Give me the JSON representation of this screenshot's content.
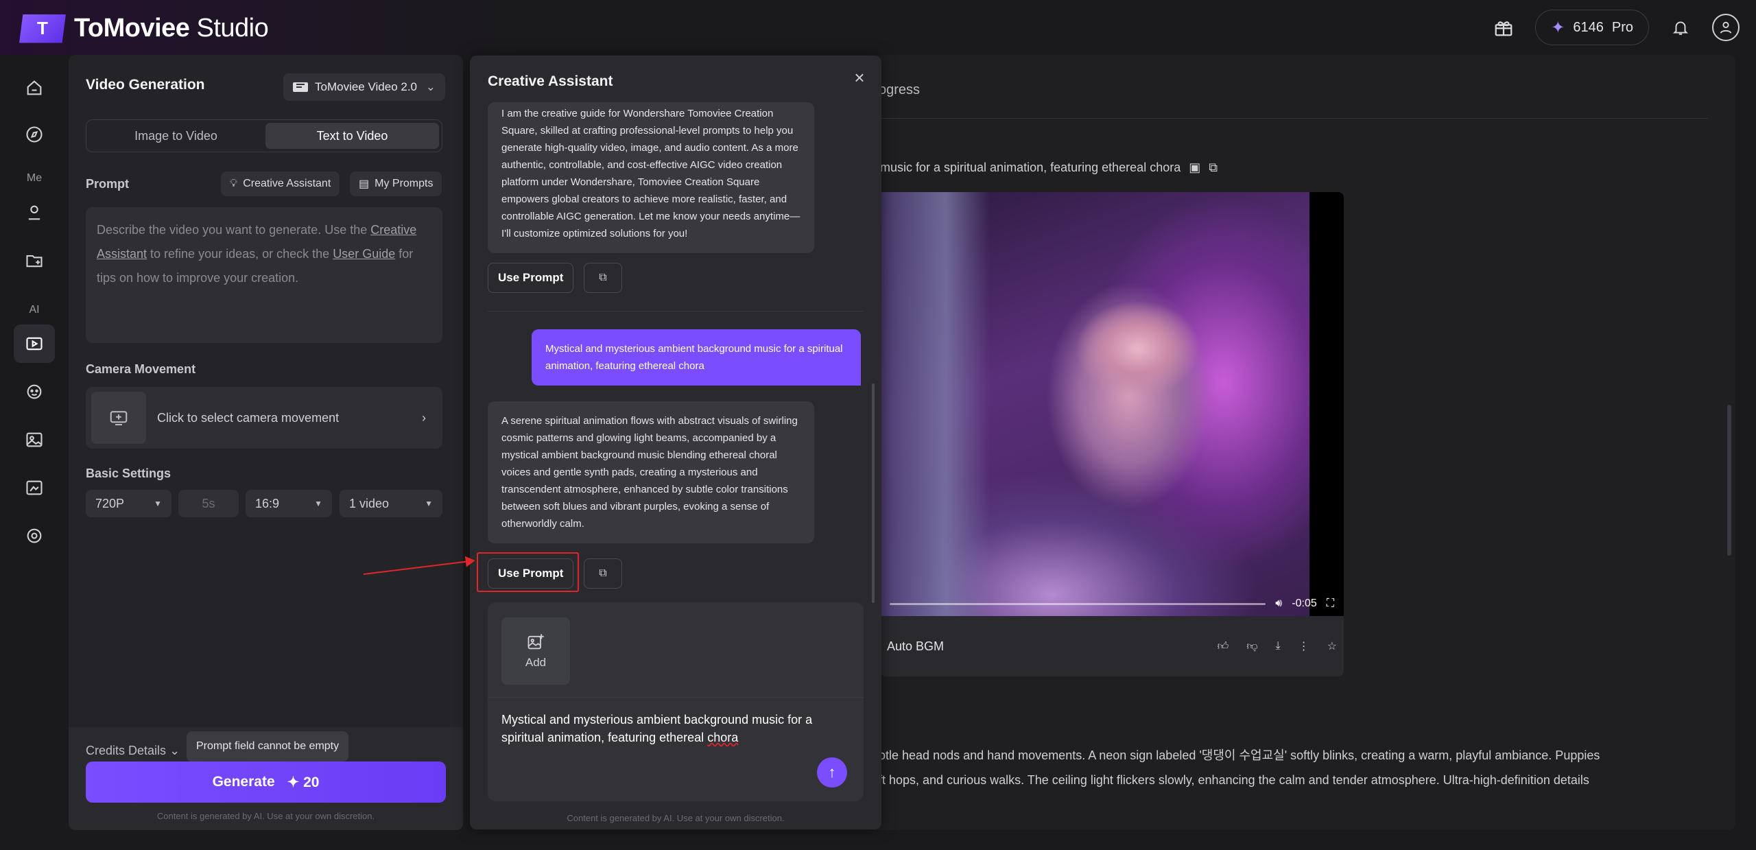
{
  "app": {
    "logo_mark": "T",
    "name_bold": "ToMoviee",
    "name_light": " Studio"
  },
  "topbar": {
    "credits": "6146",
    "plan": "Pro",
    "icons": [
      "gift-icon",
      "sparkle-icon",
      "bell-icon",
      "user-icon"
    ]
  },
  "sidenav": {
    "section_me": "Me",
    "section_ai": "AI"
  },
  "left_panel": {
    "title": "Video Generation",
    "model": "ToMoviee Video 2.0",
    "tabs": [
      "Image to Video",
      "Text to Video"
    ],
    "active_tab": "Text to Video",
    "prompt_label": "Prompt",
    "creative_assistant_chip": "Creative Assistant",
    "my_prompts_chip": "My Prompts",
    "prompt_placeholder_1": "Describe the video you want to generate. Use the ",
    "prompt_link_1": "Creative Assistant",
    "prompt_placeholder_2": " to refine your ideas, or check the ",
    "prompt_link_2": "User Guide",
    "prompt_placeholder_3": " for tips on how to improve your creation.",
    "camera_label": "Camera Movement",
    "camera_text": "Click to select camera movement",
    "basic_label": "Basic Settings",
    "settings": {
      "resolution": "720P",
      "duration": "5s",
      "ratio": "16:9",
      "count": "1 video"
    },
    "credits_details": "Credits Details",
    "tooltip": "Prompt field cannot be empty",
    "generate": "Generate",
    "generate_cost": "20",
    "disclaimer": "Content is generated by AI. Use at your own discretion."
  },
  "right_area": {
    "progress_tab": "ogress",
    "prompt_text": "music for a spiritual animation, featuring ethereal chora",
    "video_time": "-0:05",
    "bgm": "Auto BGM",
    "desc_line_1": "otle head nods and hand movements. A neon sign labeled '댕댕이 수업교실' softly blinks, creating a warm, playful ambiance. Puppies",
    "desc_line_2": "ft hops, and curious walks. The ceiling light flickers slowly, enhancing the calm and tender atmosphere. Ultra-high-definition details"
  },
  "assistant": {
    "title": "Creative Assistant",
    "intro": "I am the creative guide for Wondershare Tomoviee Creation Square, skilled at crafting professional-level prompts to help you generate high-quality video, image, and audio content. As a more authentic, controllable, and cost-effective AIGC video creation platform under Wondershare, Tomoviee Creation Square empowers global creators to achieve more realistic, faster, and controllable AIGC generation. Let me know your needs anytime—I'll customize optimized solutions for you!",
    "use_prompt": "Use Prompt",
    "user_msg": "Mystical and mysterious ambient background music for a spiritual animation, featuring ethereal chora",
    "ai_reply": "A serene spiritual animation flows with abstract visuals of swirling cosmic patterns and glowing light beams, accompanied by a mystical ambient background music blending ethereal choral voices and gentle synth pads, creating a mysterious and transcendent atmosphere, enhanced by subtle color transitions between soft blues and vibrant purples, evoking a sense of otherworldly calm.",
    "add_label": "Add",
    "input_text_main": "Mystical and mysterious ambient background music for a spiritual animation, featuring ethereal ",
    "input_text_spell": "chora",
    "disclaimer": "Content is generated by AI. Use at your own discretion."
  },
  "colors": {
    "accent": "#7a4dff",
    "annotation": "#e0262b",
    "panel": "#242428"
  }
}
